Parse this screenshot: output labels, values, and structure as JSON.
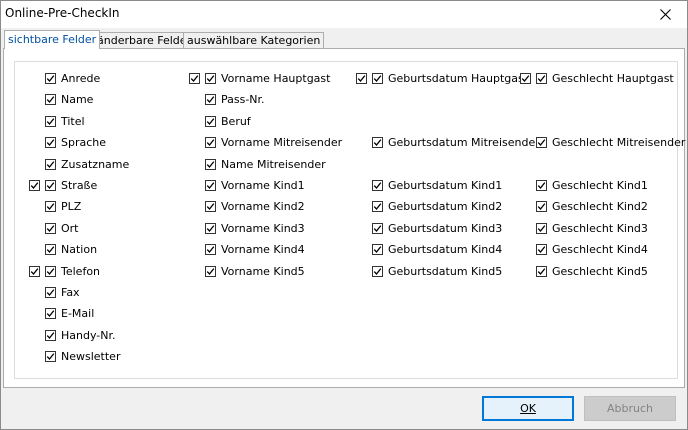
{
  "window": {
    "title": "Online-Pre-CheckIn"
  },
  "tabs": [
    {
      "label": "sichtbare Felder",
      "active": true
    },
    {
      "label": "änderbare Felder",
      "active": false
    },
    {
      "label": "auswählbare Kategorien",
      "active": false
    }
  ],
  "fields": [
    {
      "label": "Anrede",
      "checked": true,
      "group": false
    },
    {
      "label": "Name",
      "checked": true,
      "group": false
    },
    {
      "label": "Titel",
      "checked": true,
      "group": false
    },
    {
      "label": "Sprache",
      "checked": true,
      "group": false
    },
    {
      "label": "Zusatzname",
      "checked": true,
      "group": false
    },
    {
      "label": "Straße",
      "checked": true,
      "group": true
    },
    {
      "label": "PLZ",
      "checked": true,
      "group": false
    },
    {
      "label": "Ort",
      "checked": true,
      "group": false
    },
    {
      "label": "Nation",
      "checked": true,
      "group": false
    },
    {
      "label": "Telefon",
      "checked": true,
      "group": true
    },
    {
      "label": "Fax",
      "checked": true,
      "group": false
    },
    {
      "label": "E-Mail",
      "checked": true,
      "group": false
    },
    {
      "label": "Handy-Nr.",
      "checked": true,
      "group": false
    },
    {
      "label": "Newsletter",
      "checked": true,
      "group": false
    },
    {
      "label": "Vorname Hauptgast",
      "checked": true,
      "group": true
    },
    {
      "label": "Pass-Nr.",
      "checked": true,
      "group": false
    },
    {
      "label": "Beruf",
      "checked": true,
      "group": false
    },
    {
      "label": "Vorname Mitreisender",
      "checked": true,
      "group": false
    },
    {
      "label": "Name Mitreisender",
      "checked": true,
      "group": false
    },
    {
      "label": "Vorname Kind1",
      "checked": true,
      "group": false
    },
    {
      "label": "Vorname Kind2",
      "checked": true,
      "group": false
    },
    {
      "label": "Vorname Kind3",
      "checked": true,
      "group": false
    },
    {
      "label": "Vorname Kind4",
      "checked": true,
      "group": false
    },
    {
      "label": "Vorname Kind5",
      "checked": true,
      "group": false
    },
    {
      "label": "Geburtsdatum Hauptgast",
      "checked": true,
      "group": true
    },
    {
      "label": "Geburtsdatum Mitreisender",
      "checked": true,
      "group": false
    },
    {
      "label": "Geburtsdatum Kind1",
      "checked": true,
      "group": false
    },
    {
      "label": "Geburtsdatum Kind2",
      "checked": true,
      "group": false
    },
    {
      "label": "Geburtsdatum Kind3",
      "checked": true,
      "group": false
    },
    {
      "label": "Geburtsdatum Kind4",
      "checked": true,
      "group": false
    },
    {
      "label": "Geburtsdatum Kind5",
      "checked": true,
      "group": false
    },
    {
      "label": "Geschlecht Hauptgast",
      "checked": true,
      "group": true
    },
    {
      "label": "Geschlecht Mitreisender",
      "checked": true,
      "group": false
    },
    {
      "label": "Geschlecht Kind1",
      "checked": true,
      "group": false
    },
    {
      "label": "Geschlecht Kind2",
      "checked": true,
      "group": false
    },
    {
      "label": "Geschlecht Kind3",
      "checked": true,
      "group": false
    },
    {
      "label": "Geschlecht Kind4",
      "checked": true,
      "group": false
    },
    {
      "label": "Geschlecht Kind5",
      "checked": true,
      "group": false
    }
  ],
  "buttons": {
    "ok_label": "OK",
    "cancel_label": "Abbruch",
    "cancel_enabled": false
  },
  "colors": {
    "accent": "#0078d7",
    "active_tab_text": "#0050a0"
  }
}
